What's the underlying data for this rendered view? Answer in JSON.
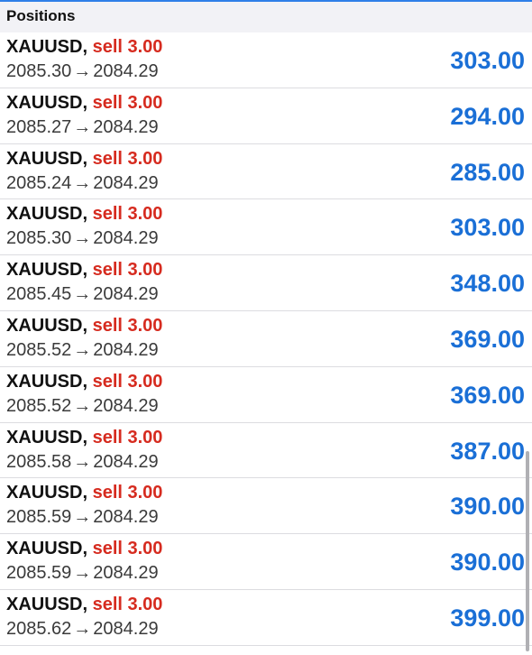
{
  "header": {
    "title": "Positions"
  },
  "separator": ", ",
  "arrow": "→",
  "colors": {
    "accent": "#2f7fe8",
    "sell": "#d62b1f",
    "profit": "#1a6fd6"
  },
  "positions": [
    {
      "symbol": "XAUUSD",
      "trade": "sell 3.00",
      "open": "2085.30",
      "current": "2084.29",
      "profit": "303.00"
    },
    {
      "symbol": "XAUUSD",
      "trade": "sell 3.00",
      "open": "2085.27",
      "current": "2084.29",
      "profit": "294.00"
    },
    {
      "symbol": "XAUUSD",
      "trade": "sell 3.00",
      "open": "2085.24",
      "current": "2084.29",
      "profit": "285.00"
    },
    {
      "symbol": "XAUUSD",
      "trade": "sell 3.00",
      "open": "2085.30",
      "current": "2084.29",
      "profit": "303.00"
    },
    {
      "symbol": "XAUUSD",
      "trade": "sell 3.00",
      "open": "2085.45",
      "current": "2084.29",
      "profit": "348.00"
    },
    {
      "symbol": "XAUUSD",
      "trade": "sell 3.00",
      "open": "2085.52",
      "current": "2084.29",
      "profit": "369.00"
    },
    {
      "symbol": "XAUUSD",
      "trade": "sell 3.00",
      "open": "2085.52",
      "current": "2084.29",
      "profit": "369.00"
    },
    {
      "symbol": "XAUUSD",
      "trade": "sell 3.00",
      "open": "2085.58",
      "current": "2084.29",
      "profit": "387.00"
    },
    {
      "symbol": "XAUUSD",
      "trade": "sell 3.00",
      "open": "2085.59",
      "current": "2084.29",
      "profit": "390.00"
    },
    {
      "symbol": "XAUUSD",
      "trade": "sell 3.00",
      "open": "2085.59",
      "current": "2084.29",
      "profit": "390.00"
    },
    {
      "symbol": "XAUUSD",
      "trade": "sell 3.00",
      "open": "2085.62",
      "current": "2084.29",
      "profit": "399.00"
    }
  ]
}
